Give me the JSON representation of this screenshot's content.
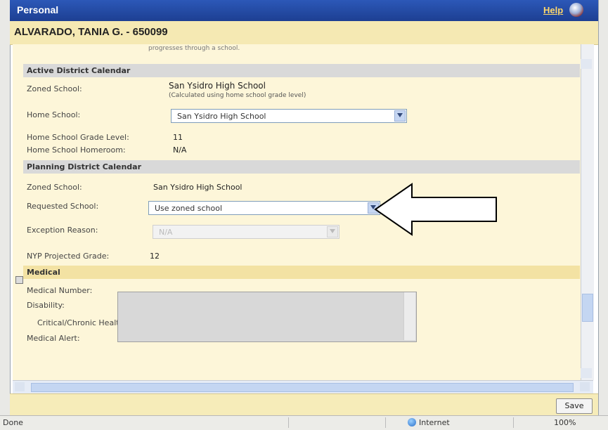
{
  "window": {
    "title": "Personal",
    "help_label": "Help"
  },
  "student": {
    "header": "ALVARADO, TANIA G. - 650099"
  },
  "top_fragment": "progresses through a school.",
  "active_calendar": {
    "title": "Active District Calendar",
    "zoned_school_label": "Zoned School:",
    "zoned_school_value": "San Ysidro High School",
    "zoned_school_note": "(Calculated using home school grade level)",
    "home_school_label": "Home School:",
    "home_school_value": "San Ysidro High School",
    "grade_level_label": "Home School Grade Level:",
    "grade_level_value": "11",
    "homeroom_label": "Home School Homeroom:",
    "homeroom_value": "N/A"
  },
  "planning_calendar": {
    "title": "Planning District Calendar",
    "zoned_school_label": "Zoned School:",
    "zoned_school_value": "San Ysidro High School",
    "requested_school_label": "Requested School:",
    "requested_school_value": "Use zoned school",
    "exception_reason_label": "Exception Reason:",
    "exception_reason_value": "N/A",
    "projected_grade_label": "NYP Projected Grade:",
    "projected_grade_value": "12"
  },
  "medical": {
    "title": "Medical",
    "number_label": "Medical Number:",
    "disability_label": "Disability:",
    "critical_label": "Critical/Chronic Health Indicator",
    "alert_label": "Medical Alert:"
  },
  "footer": {
    "save_label": "Save"
  },
  "status_bar": {
    "status": "Done",
    "zone": "Internet",
    "zoom": "100%"
  },
  "colors": {
    "title_bar": "#2c58b8",
    "header_bg": "#f5e9b3",
    "content_bg": "#fdf6d9",
    "section_bar": "#d9d9d9"
  }
}
